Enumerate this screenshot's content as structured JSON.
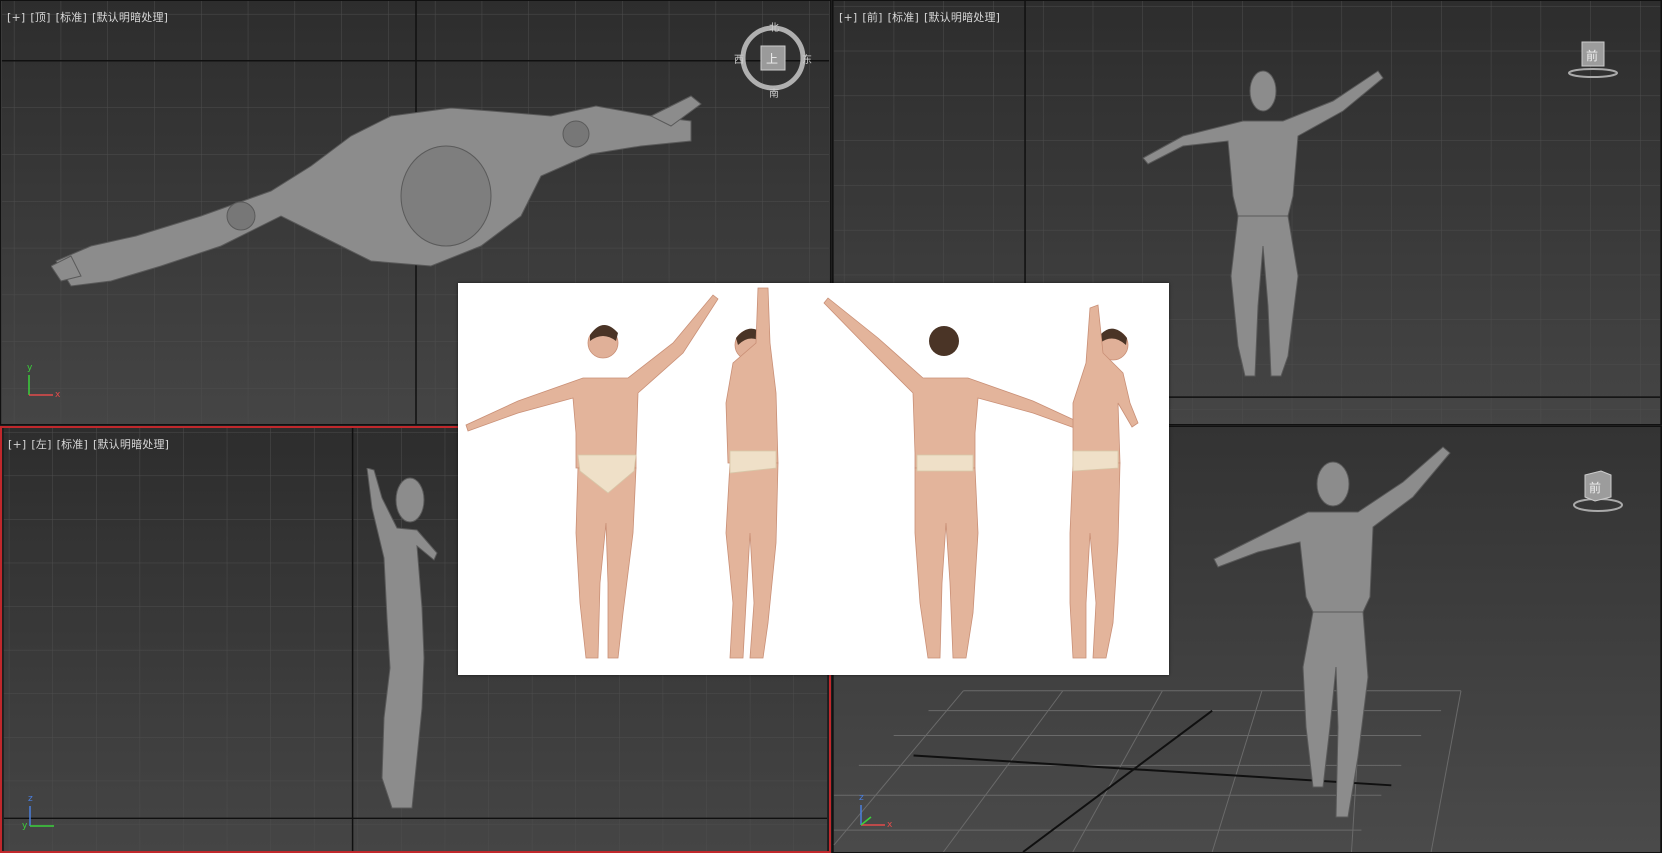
{
  "viewports": {
    "top": {
      "label_plus": "[+]",
      "label_view": "[顶]",
      "label_shading": "[标准]",
      "label_lighting": "[默认明暗处理]",
      "compass": {
        "n": "北",
        "s": "南",
        "e": "东",
        "w": "西",
        "cube": "上"
      }
    },
    "front": {
      "label_plus": "[+]",
      "label_view": "[前]",
      "label_shading": "[标准]",
      "label_lighting": "[默认明暗处理]",
      "cube": "前"
    },
    "left": {
      "label_plus": "[+]",
      "label_view": "[左]",
      "label_shading": "[标准]",
      "label_lighting": "[默认明暗处理]"
    },
    "perspective": {
      "cube": "前"
    }
  },
  "axes": {
    "x": "x",
    "y": "y",
    "z": "z"
  },
  "colors": {
    "viewport_bg": "#3c3c3c",
    "grid": "#555555",
    "active_border": "#c0282c",
    "model": "#8a8a8a",
    "skin": "#e6b9a1"
  },
  "reference_image": {
    "views": [
      "front",
      "side-right",
      "back",
      "side-left"
    ]
  }
}
